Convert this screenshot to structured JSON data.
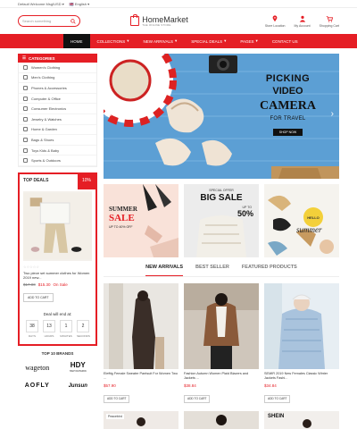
{
  "topbar": {
    "welcome": "Default Welcome Msg!",
    "currency": "USD",
    "language": "English"
  },
  "header": {
    "search_placeholder": "Search something",
    "logo_name": "HomeMarket",
    "logo_sub": "THE ONLINE STORE",
    "icons": [
      {
        "label": "Store Location"
      },
      {
        "label": "My Account"
      },
      {
        "label": "Shopping Cart",
        "badge": "0"
      }
    ]
  },
  "nav": {
    "items": [
      {
        "label": "HOME"
      },
      {
        "label": "COLLECTIONS"
      },
      {
        "label": "NEW ARRIVALS"
      },
      {
        "label": "SPECIAL DEALS"
      },
      {
        "label": "PAGES"
      },
      {
        "label": "CONTACT US"
      }
    ]
  },
  "categories": {
    "title": "CATEGORIES",
    "items": [
      "Women's Clothing",
      "Men's Clothing",
      "Phones & Accessories",
      "Computer & Office",
      "Consumer Electronics",
      "Jewelry & Watches",
      "Home & Garden",
      "Bags & Shoes",
      "Toys Kids & Baby",
      "Sports & Outdoors"
    ]
  },
  "topdeals": {
    "title": "TOP DEALS",
    "discount": "10%",
    "product_title": "Two piece set summer clothes for Women 2019 new...",
    "old_price": "$17.00",
    "new_price": "$15.30",
    "sale": "On Sale",
    "add_to_cart": "ADD TO CART",
    "deal_end": "Deal will end at:",
    "countdown": [
      {
        "value": "38",
        "label": "DAYS"
      },
      {
        "value": "13",
        "label": "HOURS"
      },
      {
        "value": "1",
        "label": "MINUTES"
      },
      {
        "value": "2",
        "label": "SECONDS"
      }
    ]
  },
  "brands": {
    "title": "TOP 10 BRANDS",
    "items": [
      "wageton",
      "HDY",
      "AOFLY",
      "Junsun"
    ],
    "hdy_sub": "HAOYOUTAIXIN"
  },
  "hero": {
    "line1": "PICKING",
    "line2": "VIDEO",
    "line3": "CAMERA",
    "line4": "FOR TRAVEL",
    "button": "SHOP NOW"
  },
  "banners": {
    "b1": {
      "line1": "SUMMER",
      "line2": "SALE",
      "line3": "UP TO 40% OFF"
    },
    "b2": {
      "line1": "SPECIAL OFFER",
      "line2": "BIG SALE",
      "line3": "UP TO",
      "line4": "50%"
    },
    "b3": {
      "line1": "HELLO",
      "line2": "summer"
    }
  },
  "tabs": [
    {
      "label": "NEW ARRIVALS",
      "active": true
    },
    {
      "label": "BEST SELLER",
      "active": false
    },
    {
      "label": "FEATURED PRODUCTS",
      "active": false
    }
  ],
  "products": [
    {
      "name": "Elefttg Female Sweater Pantsuit For Women Two ...",
      "price": "$57.90",
      "button": "ADD TO CART"
    },
    {
      "name": "Fashion Autumn Women Plaid Blazers and Jackets ...",
      "price": "$38.84",
      "button": "ADD TO CART"
    },
    {
      "name": "SEMIR 2019 New Females Classic Winter Jackets Fashi...",
      "price": "$34.84",
      "button": "ADD TO CART"
    }
  ],
  "row2": {
    "tag": "Peacebird",
    "brand": "SHEIN"
  },
  "colors": {
    "accent": "#e51e25",
    "nav_active": "#111111"
  }
}
